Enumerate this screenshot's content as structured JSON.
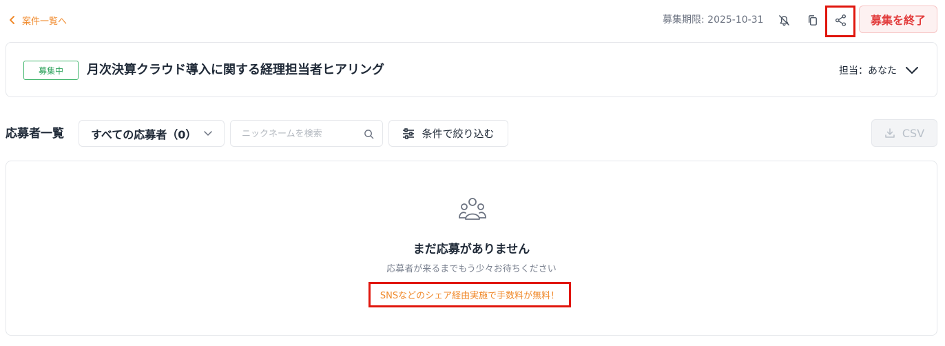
{
  "header": {
    "back_link": "案件一覧へ",
    "deadline": "募集期限: 2025-10-31",
    "end_button": "募集を終了",
    "icons": [
      "bell-off-icon",
      "copy-icon",
      "share-icon"
    ]
  },
  "job": {
    "status": "募集中",
    "title": "月次決算クラウド導入に関する経理担当者ヒアリング",
    "assignee": "担当：あなた"
  },
  "applicants": {
    "section_title": "応募者一覧",
    "filter_select": "すべての応募者（0）",
    "search_placeholder": "ニックネームを検索",
    "filter_button": "条件で絞り込む",
    "csv_button": "CSV"
  },
  "empty_state": {
    "title": "まだ応募がありません",
    "subtitle": "応募者が来るまでもう少々お待ちください",
    "promo": "SNSなどのシェア経由実施で手数料が無料！"
  },
  "colors": {
    "accent_orange": "#f08a2c",
    "danger_red": "#e23b3b",
    "status_green": "#2ea35c",
    "highlight_red": "#e0160d"
  }
}
